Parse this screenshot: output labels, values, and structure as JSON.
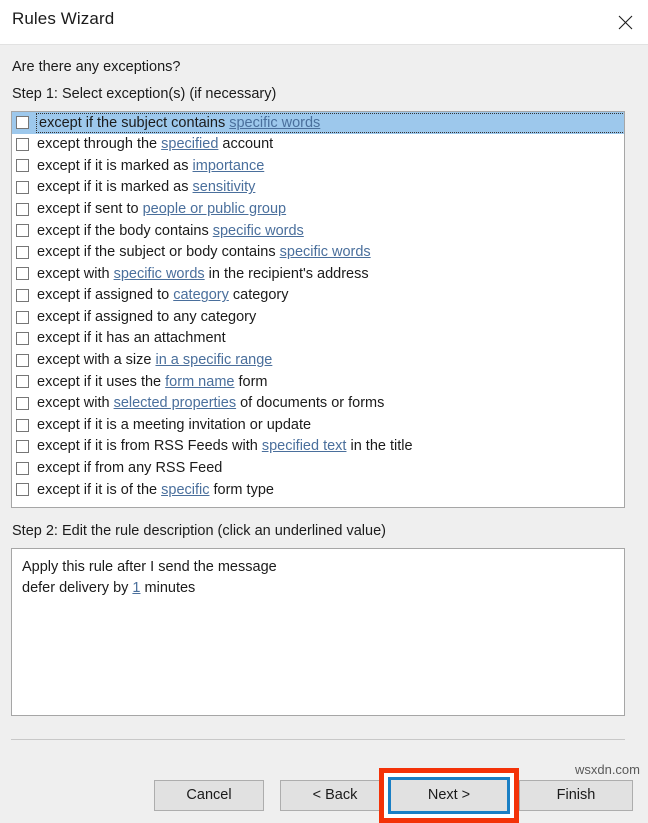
{
  "window": {
    "title": "Rules Wizard",
    "close_icon": "close-icon"
  },
  "content": {
    "question": "Are there any exceptions?",
    "step1_label": "Step 1: Select exception(s) (if necessary)",
    "step2_label": "Step 2: Edit the rule description (click an underlined value)"
  },
  "exceptions": [
    {
      "segments": [
        {
          "t": "except if the subject contains ",
          "link": false
        },
        {
          "t": "specific words",
          "link": true
        }
      ],
      "checked": false,
      "selected": true
    },
    {
      "segments": [
        {
          "t": "except through the ",
          "link": false
        },
        {
          "t": "specified",
          "link": true
        },
        {
          "t": " account",
          "link": false
        }
      ],
      "checked": false,
      "selected": false
    },
    {
      "segments": [
        {
          "t": "except if it is marked as ",
          "link": false
        },
        {
          "t": "importance",
          "link": true
        }
      ],
      "checked": false,
      "selected": false
    },
    {
      "segments": [
        {
          "t": "except if it is marked as ",
          "link": false
        },
        {
          "t": "sensitivity",
          "link": true
        }
      ],
      "checked": false,
      "selected": false
    },
    {
      "segments": [
        {
          "t": "except if sent to ",
          "link": false
        },
        {
          "t": "people or public group",
          "link": true
        }
      ],
      "checked": false,
      "selected": false
    },
    {
      "segments": [
        {
          "t": "except if the body contains ",
          "link": false
        },
        {
          "t": "specific words",
          "link": true
        }
      ],
      "checked": false,
      "selected": false
    },
    {
      "segments": [
        {
          "t": "except if the subject or body contains ",
          "link": false
        },
        {
          "t": "specific words",
          "link": true
        }
      ],
      "checked": false,
      "selected": false
    },
    {
      "segments": [
        {
          "t": "except with ",
          "link": false
        },
        {
          "t": "specific words",
          "link": true
        },
        {
          "t": " in the recipient's address",
          "link": false
        }
      ],
      "checked": false,
      "selected": false
    },
    {
      "segments": [
        {
          "t": "except if assigned to ",
          "link": false
        },
        {
          "t": "category",
          "link": true
        },
        {
          "t": " category",
          "link": false
        }
      ],
      "checked": false,
      "selected": false
    },
    {
      "segments": [
        {
          "t": "except if assigned to any category",
          "link": false
        }
      ],
      "checked": false,
      "selected": false
    },
    {
      "segments": [
        {
          "t": "except if it has an attachment",
          "link": false
        }
      ],
      "checked": false,
      "selected": false
    },
    {
      "segments": [
        {
          "t": "except with a size ",
          "link": false
        },
        {
          "t": "in a specific range",
          "link": true
        }
      ],
      "checked": false,
      "selected": false
    },
    {
      "segments": [
        {
          "t": "except if it uses the ",
          "link": false
        },
        {
          "t": "form name",
          "link": true
        },
        {
          "t": " form",
          "link": false
        }
      ],
      "checked": false,
      "selected": false
    },
    {
      "segments": [
        {
          "t": "except with ",
          "link": false
        },
        {
          "t": "selected properties",
          "link": true
        },
        {
          "t": " of documents or forms",
          "link": false
        }
      ],
      "checked": false,
      "selected": false
    },
    {
      "segments": [
        {
          "t": "except if it is a meeting invitation or update",
          "link": false
        }
      ],
      "checked": false,
      "selected": false
    },
    {
      "segments": [
        {
          "t": "except if it is from RSS Feeds with ",
          "link": false
        },
        {
          "t": "specified text",
          "link": true
        },
        {
          "t": " in the title",
          "link": false
        }
      ],
      "checked": false,
      "selected": false
    },
    {
      "segments": [
        {
          "t": "except if from any RSS Feed",
          "link": false
        }
      ],
      "checked": false,
      "selected": false
    },
    {
      "segments": [
        {
          "t": "except if it is of the ",
          "link": false
        },
        {
          "t": "specific",
          "link": true
        },
        {
          "t": " form type",
          "link": false
        }
      ],
      "checked": false,
      "selected": false
    }
  ],
  "description_lines": [
    {
      "segments": [
        {
          "t": "Apply this rule after I send the message",
          "link": false
        }
      ]
    },
    {
      "segments": [
        {
          "t": "defer delivery by ",
          "link": false
        },
        {
          "t": "1",
          "link": true
        },
        {
          "t": " minutes",
          "link": false
        }
      ]
    }
  ],
  "buttons": {
    "cancel": "Cancel",
    "back": "< Back",
    "next": "Next >",
    "finish": "Finish"
  },
  "annotation": {
    "highlight_color": "#f33208",
    "focus_color": "#1a7fc4"
  },
  "watermark": "wsxdn.com"
}
